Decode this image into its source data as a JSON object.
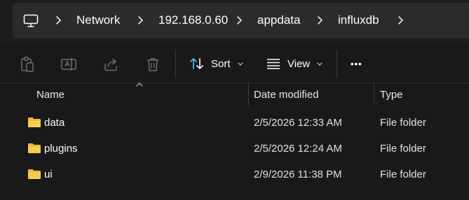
{
  "breadcrumb": {
    "items": [
      {
        "label": "Network"
      },
      {
        "label": "192.168.0.60"
      },
      {
        "label": "appdata"
      },
      {
        "label": "influxdb"
      }
    ]
  },
  "toolbar": {
    "sort_label": "Sort",
    "view_label": "View",
    "more_label": "•••"
  },
  "columns": {
    "name": "Name",
    "date_modified": "Date modified",
    "type": "Type"
  },
  "files": [
    {
      "name": "data",
      "date": "2/5/2026 12:33 AM",
      "type": "File folder"
    },
    {
      "name": "plugins",
      "date": "2/5/2026 12:24 AM",
      "type": "File folder"
    },
    {
      "name": "ui",
      "date": "2/9/2026 11:38 PM",
      "type": "File folder"
    }
  ],
  "colors": {
    "background": "#191919",
    "address_box": "#2b2b2b",
    "folder": "#f0b93a",
    "disabled_icon": "#6f6f6f",
    "accent_icon": "#4cc2ff"
  }
}
